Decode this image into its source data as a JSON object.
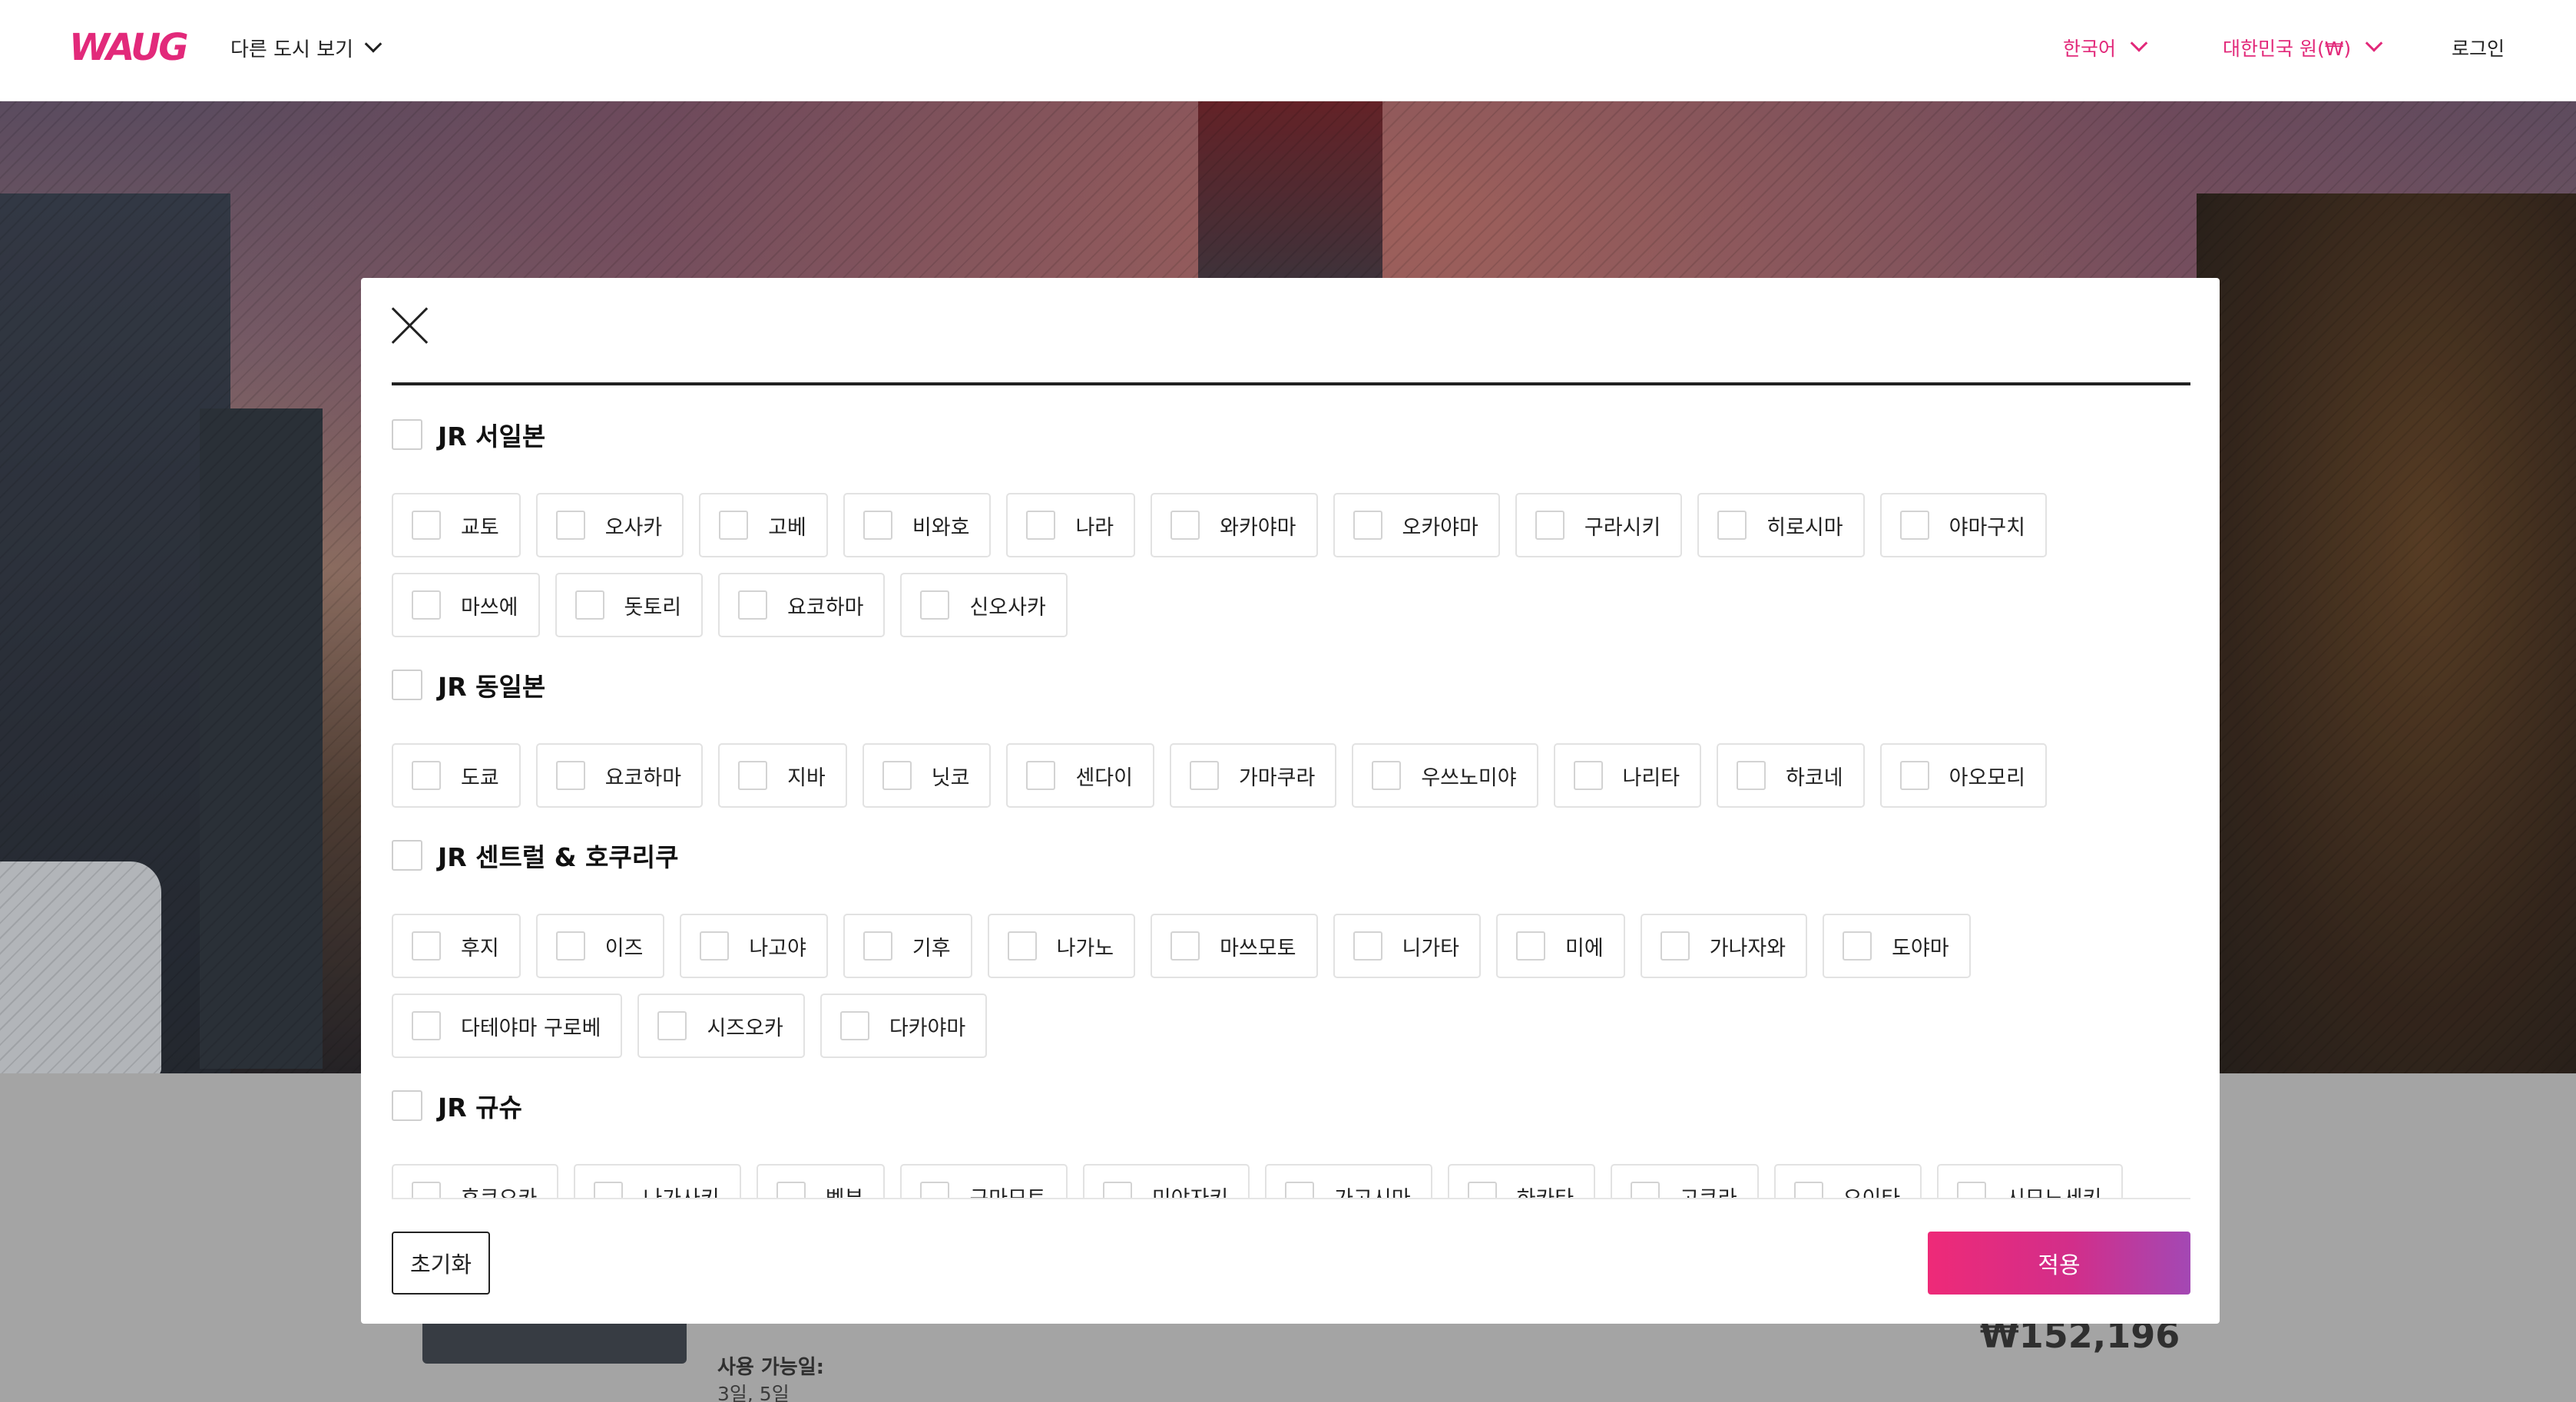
{
  "header": {
    "logo_text": "WAUG",
    "city_nav_label": "다른 도시 보기",
    "language": "한국어",
    "currency": "대한민국 원(₩)",
    "login": "로그인"
  },
  "background": {
    "availability_label": "사용 가능일:",
    "availability_value": "3일, 5일",
    "price": "₩152,196"
  },
  "modal": {
    "reset_label": "초기화",
    "apply_label": "적용",
    "groups": [
      {
        "title": "JR 서일본",
        "items": [
          "교토",
          "오사카",
          "고베",
          "비와호",
          "나라",
          "와카야마",
          "오카야마",
          "구라시키",
          "히로시마",
          "야마구치",
          "마쓰에",
          "돗토리",
          "요코하마",
          "신오사카"
        ]
      },
      {
        "title": "JR 동일본",
        "items": [
          "도쿄",
          "요코하마",
          "지바",
          "닛코",
          "센다이",
          "가마쿠라",
          "우쓰노미야",
          "나리타",
          "하코네",
          "아오모리"
        ]
      },
      {
        "title": "JR 센트럴 & 호쿠리쿠",
        "items": [
          "후지",
          "이즈",
          "나고야",
          "기후",
          "나가노",
          "마쓰모토",
          "니가타",
          "미에",
          "가나자와",
          "도야마",
          "다테야마 구로베",
          "시즈오카",
          "다카야마"
        ]
      },
      {
        "title": "JR 규슈",
        "items": [
          "후쿠오카",
          "나가사키",
          "벳부",
          "구마모토",
          "미야자키",
          "가고시마",
          "하카타",
          "고쿠라",
          "오이타",
          "시모노세키"
        ]
      }
    ]
  },
  "colors": {
    "brand_pink": "#e2297a",
    "brand_purple": "#a347b7"
  }
}
